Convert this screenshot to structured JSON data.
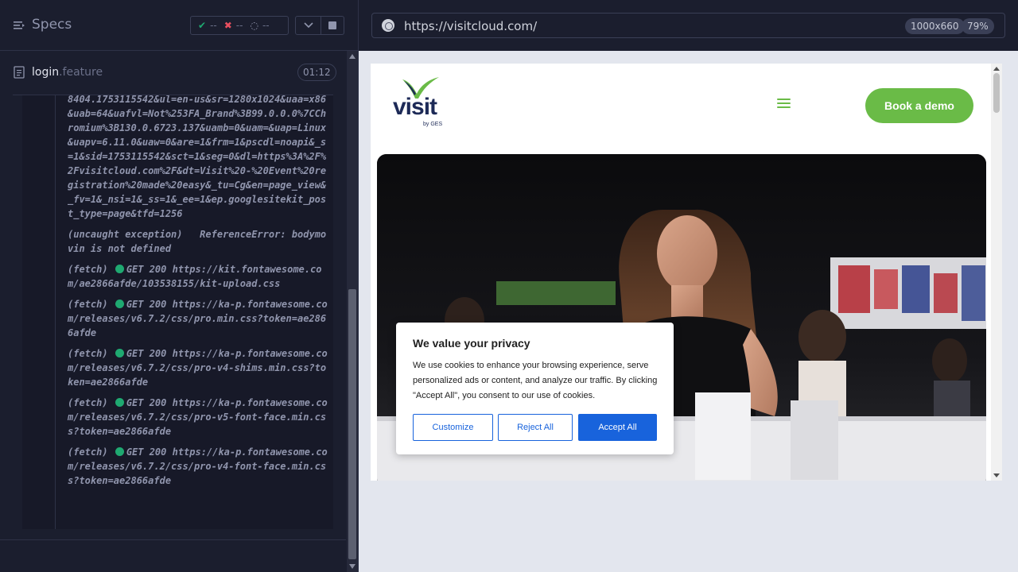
{
  "runner": {
    "title": "Specs",
    "stats": {
      "passed": "--",
      "failed": "--",
      "pending": "--"
    },
    "file": {
      "name": "login",
      "ext": ".feature",
      "duration": "01:12"
    },
    "log": [
      {
        "prefix": "",
        "status": "",
        "text": "8404.1753115542&ul=en-us&sr=1280x1024&uaa=x86&uab=64&uafvl=Not%253FA_Brand%3B99.0.0.0%7CChromium%3B130.0.6723.137&uamb=0&uam=&uap=Linux&uapv=6.11.0&uaw=0&are=1&frm=1&pscdl=noapi&_s=1&sid=1753115542&sct=1&seg=0&dl=https%3A%2F%2Fvisitcloud.com%2F&dt=Visit%20-%20Event%20registration%20made%20easy&_tu=Cg&en=page_view&_fv=1&_nsi=1&_ss=1&_ee=1&ep.googlesitekit_post_type=page&tfd=1256"
      },
      {
        "prefix": "(uncaught exception)",
        "status": "",
        "text": "  ReferenceError: bodymovin is not defined"
      },
      {
        "prefix": "(fetch)",
        "status": "ok",
        "text": "GET 200 https://kit.fontawesome.com/ae2866afde/103538155/kit-upload.css"
      },
      {
        "prefix": "(fetch)",
        "status": "ok",
        "text": "GET 200 https://ka-p.fontawesome.com/releases/v6.7.2/css/pro.min.css?token=ae2866afde"
      },
      {
        "prefix": "(fetch)",
        "status": "ok",
        "text": "GET 200 https://ka-p.fontawesome.com/releases/v6.7.2/css/pro-v4-shims.min.css?token=ae2866afde"
      },
      {
        "prefix": "(fetch)",
        "status": "ok",
        "text": "GET 200 https://ka-p.fontawesome.com/releases/v6.7.2/css/pro-v5-font-face.min.css?token=ae2866afde"
      },
      {
        "prefix": "(fetch)",
        "status": "ok",
        "text": "GET 200 https://ka-p.fontawesome.com/releases/v6.7.2/css/pro-v4-font-face.min.css?token=ae2866afde"
      }
    ]
  },
  "browser": {
    "url": "https://visitcloud.com/",
    "viewport": "1000x660",
    "zoom": "79%"
  },
  "site": {
    "logo_text": "visit",
    "logo_sub": "by GES",
    "demo_button": "Book a demo",
    "brand_green": "#6abb47",
    "brand_navy": "#1d2a57"
  },
  "cookie": {
    "title": "We value your privacy",
    "text": "We use cookies to enhance your browsing experience, serve personalized ads or content, and analyze our traffic. By clicking \"Accept All\", you consent to our use of cookies.",
    "customize": "Customize",
    "reject": "Reject All",
    "accept": "Accept All",
    "accent": "#1863dc"
  },
  "colors": {
    "pass": "#1fa971",
    "fail": "#e94f5f"
  }
}
